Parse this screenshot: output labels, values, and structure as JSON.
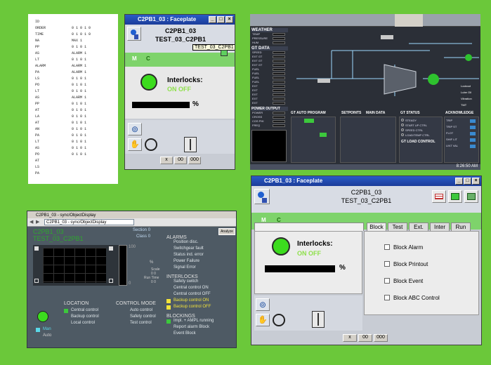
{
  "doc_scan": {
    "lines": [
      {
        "a": "ID",
        "b": ""
      },
      {
        "a": "ORDER",
        "b": "0 1 0 1 0"
      },
      {
        "a": "TIME",
        "b": "0 1 0 1 0"
      },
      {
        "a": "NA",
        "b": "MAX 1"
      },
      {
        "a": "PP",
        "b": "0 1 0 1"
      },
      {
        "a": "AS",
        "b": "ALARM 1"
      },
      {
        "a": "LT",
        "b": "0 1 0 1"
      },
      {
        "a": "ALARM",
        "b": "ALARM 1"
      },
      {
        "a": "PA",
        "b": "ALARM 1"
      },
      {
        "a": "LS",
        "b": "0 1 0 1"
      },
      {
        "a": "PO",
        "b": "0 1 0 1"
      },
      {
        "a": "LT",
        "b": "0 1 0 1"
      },
      {
        "a": "AS",
        "b": "ALARM 1"
      },
      {
        "a": "PP",
        "b": "0 1 0 1"
      },
      {
        "a": "AT",
        "b": "0 1 0 1"
      },
      {
        "a": "LA",
        "b": "0 1 0 1"
      },
      {
        "a": "AT",
        "b": "0 1 0 1"
      },
      {
        "a": "AN",
        "b": "0 1 0 1"
      },
      {
        "a": "PA",
        "b": "0 1 0 1"
      },
      {
        "a": "LT",
        "b": "0 1 0 1"
      },
      {
        "a": "AS",
        "b": "0 1 0 1"
      },
      {
        "a": "PO",
        "b": "0 1 0 1"
      },
      {
        "a": "AT",
        "b": ""
      },
      {
        "a": "LS",
        "b": ""
      },
      {
        "a": "PA",
        "b": ""
      }
    ]
  },
  "faceplate_small": {
    "title": "C2PB1_03 : Faceplate",
    "name": "C2PB1_03",
    "tag": "TEST_03_C2PB1",
    "mode_m": "M",
    "mode_c": "C",
    "tooltip": "TEST_03_C2PB1",
    "interlocks_label": "Interlocks:",
    "interlocks_state": "ON OFF",
    "percent": "%",
    "nav_buttons": [
      "x",
      "00",
      "000"
    ]
  },
  "scada": {
    "sections": {
      "weather": "WEATHER",
      "gt_data": "GT DATA",
      "power_output": "POWER OUTPUT",
      "gt_auto_program": "GT AUTO PROGRAM",
      "setpoints": "SETPOINTS",
      "main_data": "MAIN DATA",
      "gt_status": "GT STATUS",
      "acknowledge": "ACKNOWLEDGE",
      "gt_load_control": "GT LOAD CONTROL"
    },
    "weather_rows": [
      "TEMP",
      "PRESSURE",
      "HUM"
    ],
    "gt_rows": [
      "SPEED",
      "EXT GT",
      "EXT GT",
      "EXT GT",
      "FUEL",
      "FUEL",
      "FUEL",
      "FUEL",
      "EXT",
      "EXT",
      "EXT",
      "EXT",
      "EXT"
    ],
    "power_rows": [
      "POWER",
      "CROSS",
      "COS PHI",
      "FREQ"
    ],
    "status_items": [
      "STEADY",
      "START UP CTRL",
      "SPEED CTRL",
      "LOAD/TEMP CTRL"
    ],
    "ack_items": [
      "TRIP",
      "TRIP ST",
      "FLOT",
      "SHIF LIT",
      "LINT VAL"
    ],
    "labels_right": [
      "Lockout",
      "Lube Oil",
      "Vibration",
      "TMT"
    ],
    "time": "8:26:50 AM"
  },
  "object_display": {
    "window_title": "C2PB1_03 - sync/ObjectDisplay",
    "address": "C2PB1_03 - sync/ObjectDisplay",
    "name": "C2PB1_03",
    "tag": "TEST_03_C2PB1",
    "section_label": "Section",
    "section_value": "0",
    "class_label": "Class",
    "class_value": "0",
    "analyze_label": "Analyze",
    "alarms_header": "ALARMS",
    "alarms": [
      "Position disc.",
      "Switchgear fault",
      "Status ind. error",
      "Power Failure",
      "Signal Error"
    ],
    "interlocks_header": "INTERLOCKS",
    "interlocks": [
      {
        "label": "Safety switch",
        "marker": false
      },
      {
        "label": "Central control ON",
        "marker": false
      },
      {
        "label": "Central control OFF",
        "marker": false
      },
      {
        "label": "Backup control ON",
        "marker": true
      },
      {
        "label": "Backup control OFF",
        "marker": true
      }
    ],
    "blockings_header": "BLOCKINGS",
    "blockings": [
      {
        "label": "Impl. + AMPL running",
        "marker": true
      },
      {
        "label": "Report alarm Block",
        "marker": false
      },
      {
        "label": "Event Block",
        "marker": false
      }
    ],
    "location_header": "LOCATION",
    "locations": [
      {
        "label": "Central control",
        "marker": true
      },
      {
        "label": "Backup control",
        "marker": false
      },
      {
        "label": "Local control",
        "marker": false
      }
    ],
    "control_mode_header": "CONTROL MODE",
    "control_modes": [
      "Auto control",
      "Safety control",
      "Test control"
    ],
    "man_label": "Man",
    "auto_label": "Auto",
    "scale_label": "Scale",
    "scale_value": "0  0",
    "run_time_label": "Run Time",
    "run_time_value": "0  0",
    "rate_label": "%",
    "value_0": "0",
    "value_100": "100"
  },
  "faceplate_large": {
    "title": "C2PB1_03 : Faceplate",
    "name": "C2PB1_03",
    "tag": "TEST_03_C2PB1",
    "mode_m": "M",
    "mode_c": "C",
    "interlocks_label": "Interlocks:",
    "interlocks_state": "ON OFF",
    "percent": "%",
    "tabs": [
      "Block",
      "Test",
      "Ext.",
      "Inter",
      "Run"
    ],
    "checkboxes": [
      "Block Alarm",
      "Block Printout",
      "Block Event",
      "Block ABC Control"
    ],
    "nav_buttons": [
      "x",
      "00",
      "000"
    ]
  }
}
